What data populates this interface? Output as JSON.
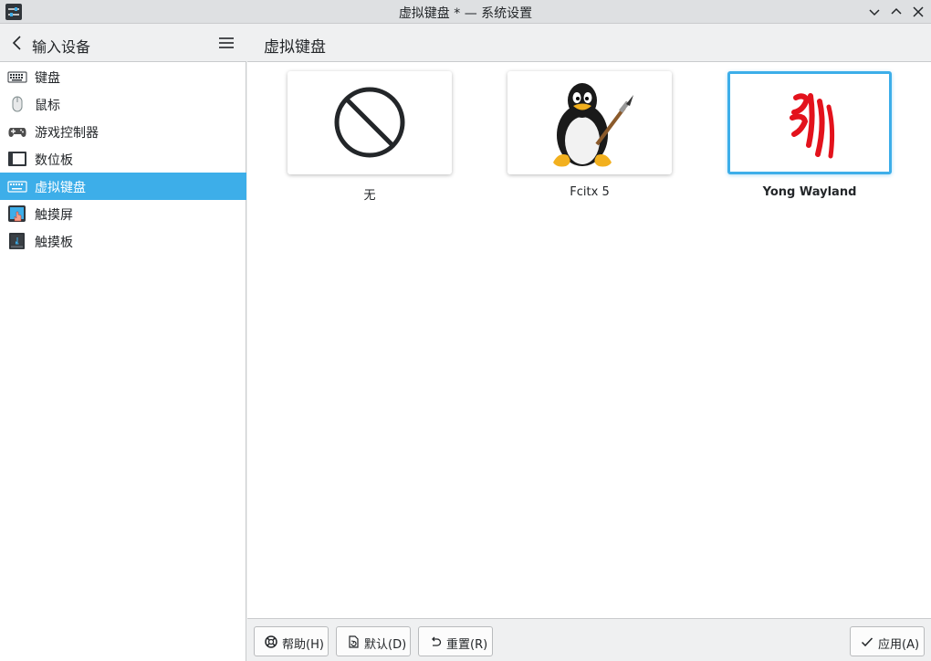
{
  "window": {
    "title": "虚拟键盘 * — 系统设置"
  },
  "sidebar": {
    "title": "输入设备",
    "items": [
      {
        "label": "键盘",
        "icon": "keyboard-icon",
        "selected": false
      },
      {
        "label": "鼠标",
        "icon": "mouse-icon",
        "selected": false
      },
      {
        "label": "游戏控制器",
        "icon": "gamepad-icon",
        "selected": false
      },
      {
        "label": "数位板",
        "icon": "tablet-icon",
        "selected": false
      },
      {
        "label": "虚拟键盘",
        "icon": "virtual-keyboard-icon",
        "selected": true
      },
      {
        "label": "触摸屏",
        "icon": "touchscreen-icon",
        "selected": false
      },
      {
        "label": "触摸板",
        "icon": "touchpad-icon",
        "selected": false
      }
    ]
  },
  "main": {
    "title": "虚拟键盘",
    "options": [
      {
        "label": "无",
        "icon": "none-icon",
        "selected": false
      },
      {
        "label": "Fcitx 5",
        "icon": "tux-penguin-icon",
        "selected": false
      },
      {
        "label": "Yong Wayland",
        "icon": "yong-logo-icon",
        "selected": true
      }
    ]
  },
  "footer": {
    "help_label": "帮助(H)",
    "defaults_label": "默认(D)",
    "reset_label": "重置(R)",
    "apply_label": "应用(A)"
  },
  "colors": {
    "accent": "#3daee9",
    "background": "#eff0f1",
    "text": "#232629"
  }
}
